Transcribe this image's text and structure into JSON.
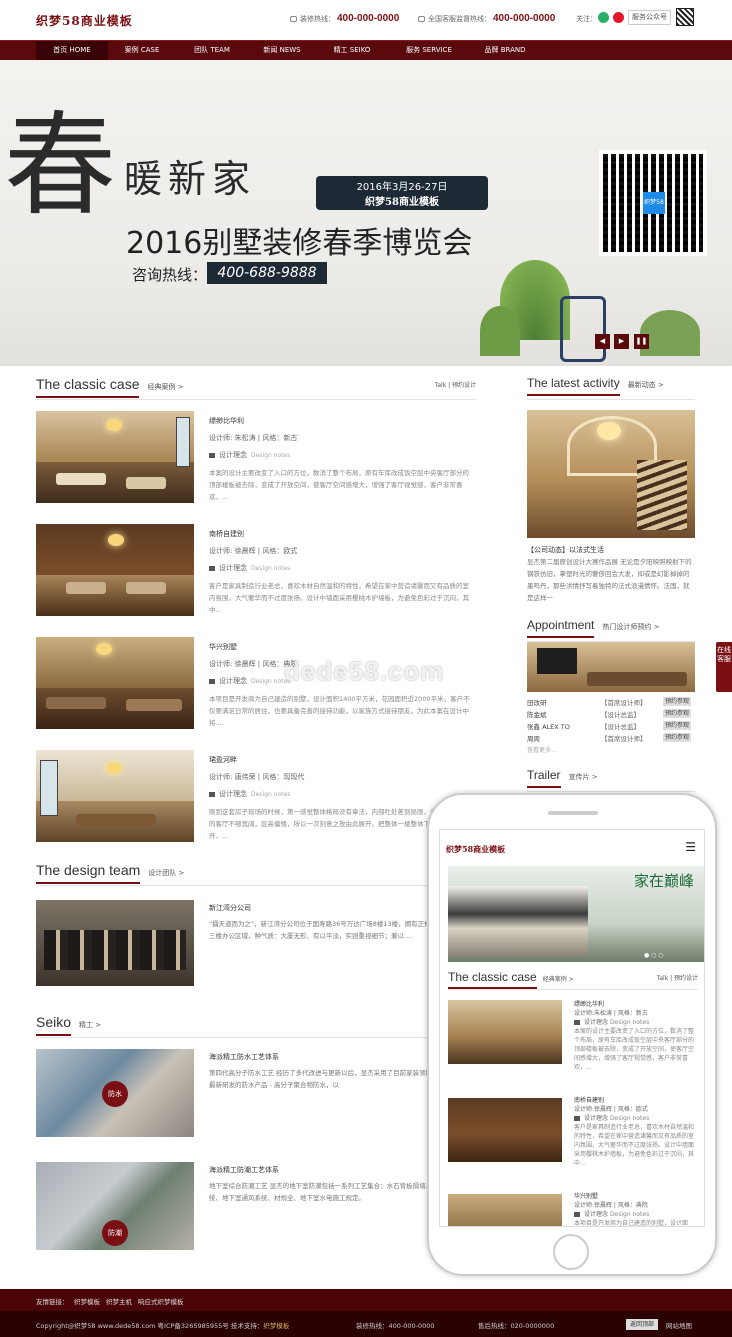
{
  "header": {
    "logo": "织梦58商业模板",
    "hotline1_label": "装修热线：",
    "hotline1": "400-000-0000",
    "hotline2_label": "全国客服监督热线：",
    "hotline2": "400-000-0000",
    "follow": "关注：",
    "service_account": "服务公众号"
  },
  "nav": [
    {
      "label": "首页 HOME"
    },
    {
      "label": "案例 CASE"
    },
    {
      "label": "团队 TEAM"
    },
    {
      "label": "新闻 NEWS"
    },
    {
      "label": "精工 SEIKO"
    },
    {
      "label": "服务 SERVICE"
    },
    {
      "label": "品牌 BRAND"
    }
  ],
  "banner": {
    "big_char": "春",
    "tagline": "暖新家",
    "date": "2016年3月26-27日",
    "date_sub": "织梦58商业模板",
    "expo": "2016别墅装修春季博览会",
    "consult": "咨询热线：",
    "phone": "400-688-9888",
    "qr_badge": "织梦58"
  },
  "classic_case": {
    "en": "The classic case",
    "cn": "经典案例 >",
    "right": "Talk | 预约设计",
    "items": [
      {
        "title": "缥缈比华利",
        "meta": "设计师: 朱松涛 | 风格：新古",
        "note": "设计理念",
        "note_en": "Design notes",
        "desc": "本案的设计主要改变了入口的方位，数消了整个布局，原有车库改成饭空层中央客厅部分的顶部楼板被去除，变成了开放空间，使客厅空间感增大，增强了客厅视觉感，客户非常喜欢，..."
      },
      {
        "title": "南桥自建别",
        "meta": "设计师: 徐晨辉 | 风格：欧式",
        "note": "设计理念",
        "note_en": "Design notes",
        "desc": "客户是家具制造行业老总，喜欢木材自然温和的特性，希望在家中营造诸馨而又有品质的室内氛围，大气奢华而不过度张扬。设计中墙面采用樱桃木护墙板，为避免色彩过于沉闷，其中..."
      },
      {
        "title": "华兴别墅",
        "meta": "设计师: 徐晨辉 | 风格：典院",
        "note": "设计理念",
        "note_en": "Design notes",
        "desc": "本项目是开发商为自己建造的别墅，设计面积1400平方米，花园面积近2000平米。客户不仅要满足日常的居住，也要具备完善的接待功能，以家族方式接待朋友，为此本案在设计中将...."
      },
      {
        "title": "珺盈河畔",
        "meta": "设计师: 唐伟荣 | 风格：现现代",
        "note": "设计理念",
        "note_en": "Design notes",
        "desc": "刚到这套房子现场的时候，第一感觉整体格局没有章法，内部吐处差到局限，造成大气宽敞的客厅不够宽阔，层高偏矮，所以一次刻意之放由此展开。把整体一楼整体下沉使原本的厅开，..."
      }
    ]
  },
  "team": {
    "en": "The design team",
    "cn": "设计团队 >",
    "title": "新江湾分公司",
    "desc": "\"擂天道而为之\"，新江湾分公司位于国寿路36号万达广场8楼13楼，拥有正规的三楼办公区域，种气质：大厦无形、有以平淡，实则重视细节；兼以...."
  },
  "seiko": {
    "en": "Seiko",
    "cn": "精工 >",
    "items": [
      {
        "title": "海派精工防水工艺体系",
        "desc": "第四代高分子防水工艺 经历了多代改进与更新以后，显杰采用了目前家装领域中最新研发的防水产品 - 高分子聚合物防水，以",
        "badge": "防水"
      },
      {
        "title": "海派精工防潮工艺体系",
        "desc": "地下室综合防潮工艺 显杰的地下室防潮包括一系列工艺集合：水石背板隔墙系统、地下室通风系统、材规全、地下室水电施工规定。",
        "badge": "防潮"
      }
    ]
  },
  "activity": {
    "en": "The latest activity",
    "cn": "最新动态 >",
    "title": "【公司动态】以法式生活",
    "desc": "显杰第二届原创设计大赛作品展 无论是夕阳映照映射下的钢铁仿旧，拿塑时光的奢侈回会大发，抑或是幻影掉掉的墨吗丹，那些洪情抒写着独特的法式浪漫情怀。法国，就是这样一"
  },
  "appointment": {
    "en": "Appointment",
    "cn": "热门设计师预约 >",
    "rows": [
      {
        "name": "田改研",
        "level": "【首席设计师】",
        "btn": "预约参观"
      },
      {
        "name": "陈金斌",
        "level": "【设计总监】",
        "btn": "预约参观"
      },
      {
        "name": "张鑫 ALEX TO",
        "level": "【设计总监】",
        "btn": "预约参观"
      },
      {
        "name": "周周",
        "level": "【首席设计师】",
        "btn": "预约参观"
      }
    ],
    "more": "查看更多..."
  },
  "trailer": {
    "en": "Trailer",
    "cn": "宣传片 >"
  },
  "side_tab": "在线客服",
  "watermark": "dede58.com",
  "mobile": {
    "logo": "织梦58商业模板",
    "banner_text": "家在巅峰",
    "section_en": "The classic case",
    "section_cn": "经典案例 >",
    "section_right": "Talk | 预约设计",
    "items": [
      {
        "title": "缥缈比华利",
        "meta": "设计师:朱松涛 | 风格：新古",
        "note": "设计理念",
        "note_en": "Design notes",
        "desc": "本案的设计主要改变了入口的方位，数消了整个布局，原有车库改成饭空层中央客厅部分的顶部楼板被去除，变成了开放空间，使客厅空间感增大，增强了客厅视觉感，客户非常喜欢，..."
      },
      {
        "title": "南桥自建别",
        "meta": "设计师:徐晨辉 | 风格：欧式",
        "note": "设计理念",
        "note_en": "Design notes",
        "desc": "客户是家具制造行业老总，喜欢木材自然温和的特性，希望在家中营造诸馨而又有品质的室内氛围，大气奢华而不过度张扬。设计中墙面采用樱桃木护墙板，为避免色彩过于沉闷，其中..."
      },
      {
        "title": "华兴别墅",
        "meta": "设计师:徐晨辉 | 风格：典院",
        "note": "设计理念",
        "note_en": "Design notes",
        "desc": "本项目是开发商为自己建造的别墅，设计面积..."
      }
    ]
  },
  "footer": {
    "links_label": "友情链接：",
    "links": [
      "织梦模板",
      "织梦主机",
      "响应式织梦模板"
    ],
    "copyright": "Copyright@织梦58 www.dede58.com 粤ICP备3265985955号  技术支持：",
    "support": "织梦模板",
    "hot1_label": "装修热线：",
    "hot1": "400-000-0000",
    "hot2_label": "售后热线：",
    "hot2": "020-0000000",
    "back_top": "返回顶部",
    "sitemap": "网站地图"
  },
  "colors": {
    "brand": "#7a1014",
    "nav_bg": "#5a0a0c",
    "footer_bg": "#2b0203"
  }
}
